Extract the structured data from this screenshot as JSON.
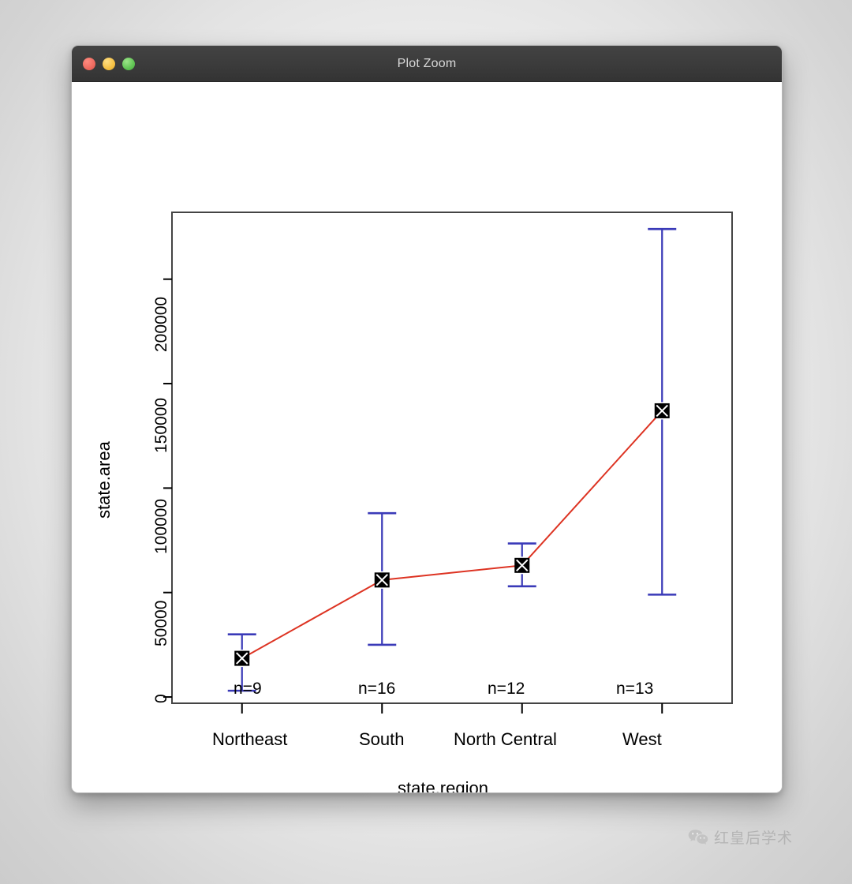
{
  "window": {
    "title": "Plot Zoom",
    "traffic_lights": [
      {
        "name": "close-button",
        "color": "#ee6a5f"
      },
      {
        "name": "minimize-button",
        "color": "#f5c043"
      },
      {
        "name": "maximize-button",
        "color": "#61c454"
      }
    ]
  },
  "watermark": {
    "icon": "wechat-icon",
    "text": "红皇后学术"
  },
  "chart_data": {
    "type": "line",
    "title": "",
    "xlabel": "state.region",
    "ylabel": "state.area",
    "categories": [
      "Northeast",
      "South",
      "North Central",
      "West"
    ],
    "values": [
      18500,
      56000,
      63000,
      137000
    ],
    "error_upper": [
      30000,
      88000,
      73500,
      224000
    ],
    "error_lower": [
      3000,
      25000,
      53000,
      49000
    ],
    "n_labels": [
      "n=9",
      "n=16",
      "n=12",
      "n=13"
    ],
    "counts": [
      9,
      16,
      12,
      13
    ],
    "ylim": [
      -3000,
      232000
    ],
    "yticks": [
      0,
      50000,
      100000,
      150000,
      200000
    ],
    "ytick_labels": [
      "0",
      "50000",
      "100000",
      "150000",
      "200000"
    ],
    "grid": false,
    "legend": "none",
    "line_color": "#dd3322",
    "error_bar_color": "#3a3ab8",
    "point_color": "#000000",
    "point_marker": "square-with-x",
    "axis_color": "#000000"
  }
}
